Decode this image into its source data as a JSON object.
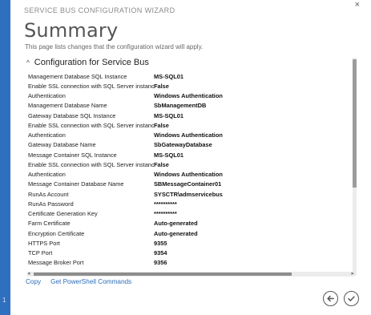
{
  "window": {
    "title": "SERVICE BUS CONFIGURATION WIZARD",
    "close_glyph": "×"
  },
  "page": {
    "title": "Summary",
    "description": "This page lists changes that the configuration wizard will apply."
  },
  "section": {
    "caret_glyph": "^",
    "title": "Configuration for Service Bus"
  },
  "rows": [
    {
      "label": "Management Database SQL Instance",
      "value": "MS-SQL01"
    },
    {
      "label": "Enable SSL connection with SQL Server instance",
      "value": "False"
    },
    {
      "label": "Authentication",
      "value": "Windows Authentication"
    },
    {
      "label": "Management Database Name",
      "value": "SbManagementDB"
    },
    {
      "label": "Gateway Database SQL Instance",
      "value": "MS-SQL01"
    },
    {
      "label": "Enable SSL connection with SQL Server instance",
      "value": "False"
    },
    {
      "label": "Authentication",
      "value": "Windows Authentication"
    },
    {
      "label": "Gateway Database Name",
      "value": "SbGatewayDatabase"
    },
    {
      "label": "Message Container SQL Instance",
      "value": "MS-SQL01"
    },
    {
      "label": "Enable SSL connection with SQL Server instance",
      "value": "False"
    },
    {
      "label": "Authentication",
      "value": "Windows Authentication"
    },
    {
      "label": "Message Container Database Name",
      "value": "SBMessageContainer01"
    },
    {
      "label": "RunAs Account",
      "value": "SYSCTR\\admservicebus"
    },
    {
      "label": "RunAs Password",
      "value": "**********"
    },
    {
      "label": "Certificate Generation Key",
      "value": "**********"
    },
    {
      "label": "Farm Certificate",
      "value": "Auto-generated"
    },
    {
      "label": "Encryption Certificate",
      "value": "Auto-generated"
    },
    {
      "label": "HTTPS Port",
      "value": "9355"
    },
    {
      "label": "TCP Port",
      "value": "9354"
    },
    {
      "label": "Message Broker Port",
      "value": "9356"
    }
  ],
  "links": {
    "copy": "Copy",
    "powershell": "Get PowerShell Commands"
  },
  "side_strip": {
    "marker": "1"
  },
  "colors": {
    "accent": "#2f6fc0",
    "link": "#2a6db8"
  },
  "icons": {
    "back": "back-arrow-icon",
    "finish": "checkmark-icon",
    "close": "close-icon"
  }
}
